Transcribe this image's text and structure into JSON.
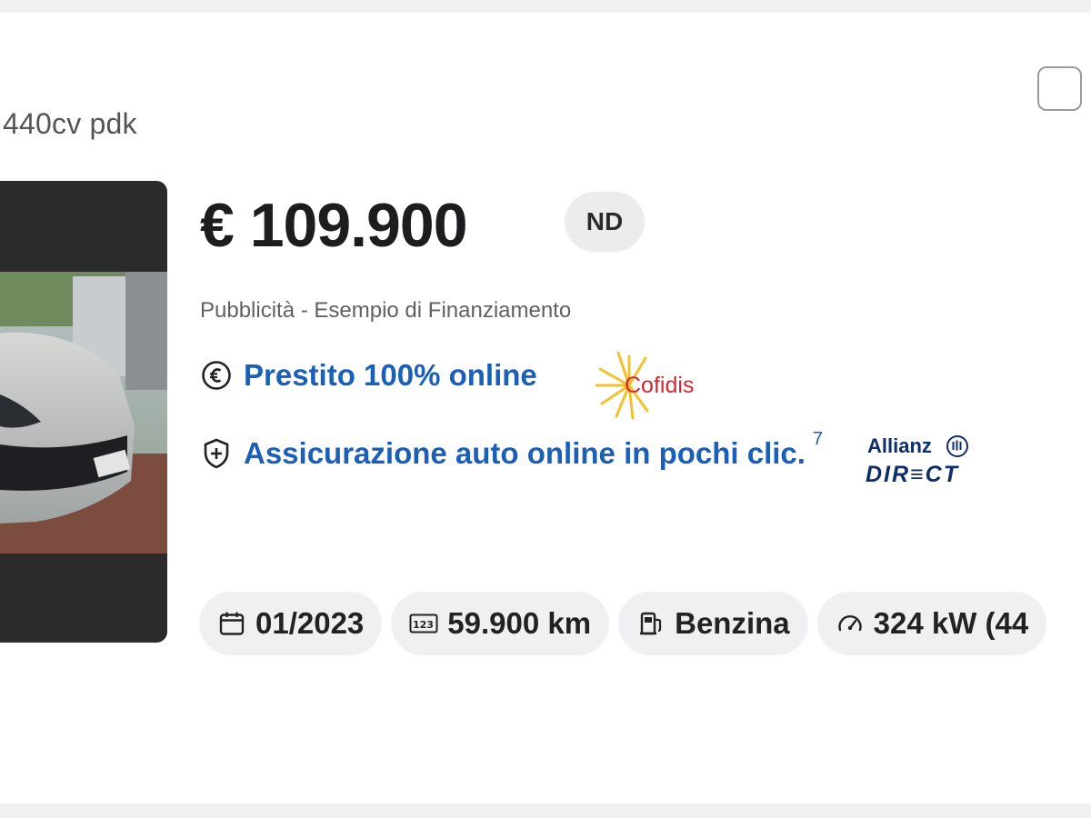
{
  "listing": {
    "title_fragment": "440cv pdk",
    "price": "€ 109.900",
    "price_badge": "ND"
  },
  "financing": {
    "ad_label": "Pubblicità - Esempio di Finanziamento",
    "loan_link": "Prestito 100% online",
    "loan_partner": "Cofidis",
    "insurance_link": "Assicurazione auto online in pochi clic.",
    "insurance_note_ref": "7",
    "insurance_partner_line1": "Allianz",
    "insurance_partner_line2": "DIR≡CT"
  },
  "specs": [
    {
      "icon": "calendar-icon",
      "value": "01/2023"
    },
    {
      "icon": "odometer-icon",
      "value": "59.900 km"
    },
    {
      "icon": "fuel-pump-icon",
      "value": "Benzina"
    },
    {
      "icon": "speedometer-icon",
      "value": "324 kW (44"
    }
  ],
  "colors": {
    "link": "#1b5fb6",
    "cofidis_red": "#d6262f",
    "cofidis_sun": "#f2c12e",
    "allianz_blue": "#0f2c6b"
  }
}
